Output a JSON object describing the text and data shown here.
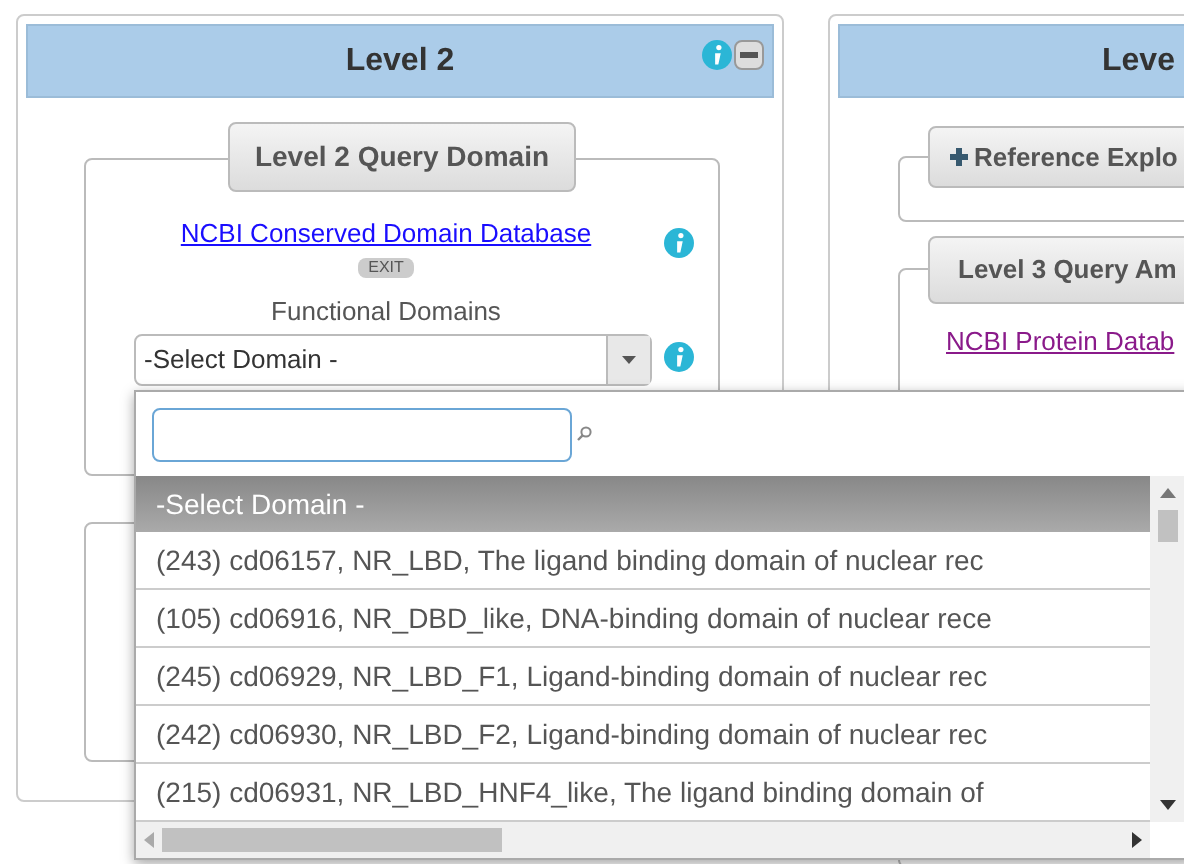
{
  "left_panel": {
    "title": "Level 2",
    "query_button": "Level 2 Query Domain",
    "database_link": "NCBI Conserved Domain Database",
    "exit_badge": "EXIT",
    "domains_label": "Functional Domains",
    "domain_select": {
      "value": "-Select Domain -"
    }
  },
  "right_panel": {
    "title": "Leve",
    "reference_button": "Reference Explo",
    "query_button": "Level 3 Query Am",
    "database_link": "NCBI Protein Datab"
  },
  "dropdown": {
    "options": [
      {
        "label": "-Select Domain -",
        "selected": true
      },
      {
        "label": "(243) cd06157, NR_LBD, The ligand binding domain of nuclear rec",
        "selected": false
      },
      {
        "label": "(105) cd06916, NR_DBD_like, DNA-binding domain of nuclear rece",
        "selected": false
      },
      {
        "label": "(245) cd06929, NR_LBD_F1, Ligand-binding domain of nuclear rec",
        "selected": false
      },
      {
        "label": "(242) cd06930, NR_LBD_F2, Ligand-binding domain of nuclear rec",
        "selected": false
      },
      {
        "label": "(215) cd06931, NR_LBD_HNF4_like, The ligand binding domain of",
        "selected": false
      }
    ]
  }
}
